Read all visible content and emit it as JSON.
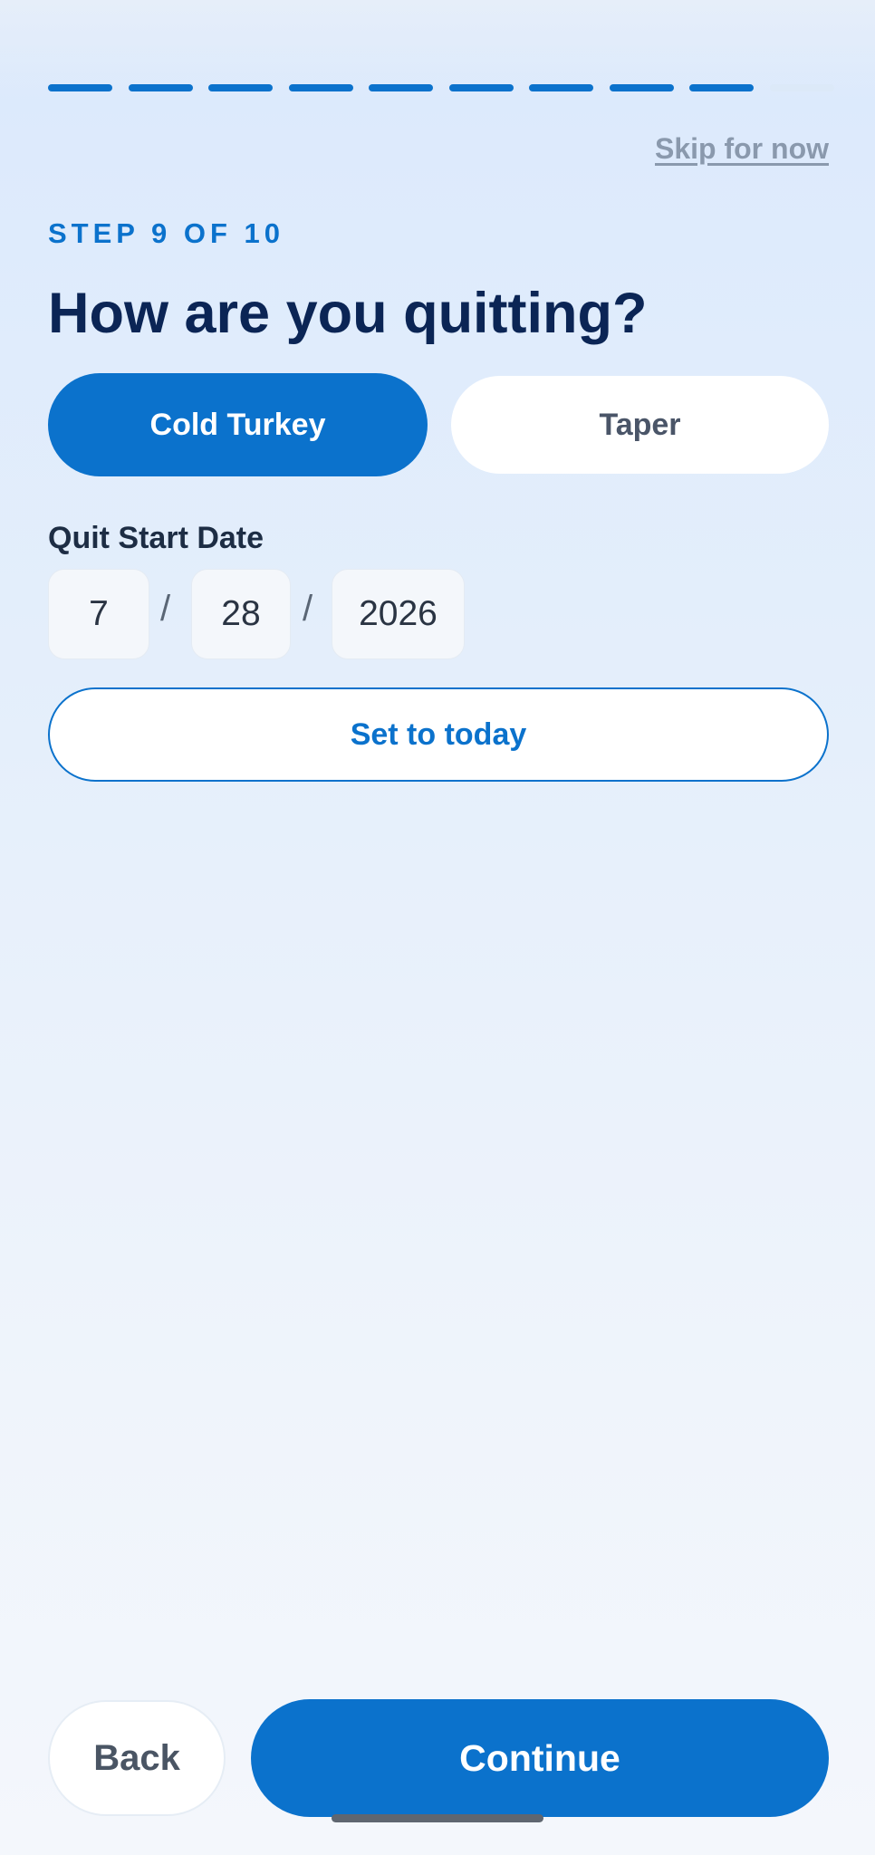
{
  "progress": {
    "current": 9,
    "total": 10
  },
  "header": {
    "skip_label": "Skip for now",
    "step_label": "STEP 9 OF 10",
    "title": "How are you quitting?"
  },
  "method": {
    "options": [
      {
        "label": "Cold Turkey",
        "selected": true
      },
      {
        "label": "Taper",
        "selected": false
      }
    ]
  },
  "quit_date": {
    "label": "Quit Start Date",
    "month": "7",
    "day": "28",
    "year": "2026",
    "separator": "/",
    "set_today_label": "Set to today"
  },
  "footer": {
    "back_label": "Back",
    "continue_label": "Continue"
  },
  "colors": {
    "accent": "#0b72cc",
    "title": "#0b2555",
    "inactive_segment": "#dce9f8"
  }
}
